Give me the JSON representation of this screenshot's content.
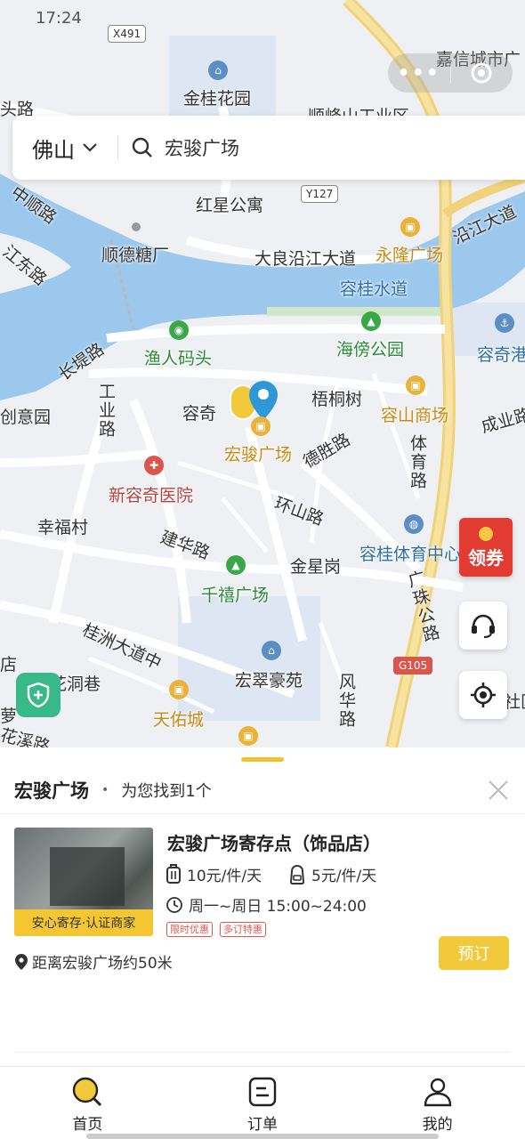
{
  "status_bar": {
    "time": "17:24"
  },
  "capsule": {
    "more_label": "•••"
  },
  "search": {
    "city": "佛山",
    "query": "宏骏广场"
  },
  "map": {
    "labels": {
      "x491": "X491",
      "jinguihuayuan": "金桂花园",
      "shunfengshan": "顺峰山工业区",
      "jiaxincheng": "嘉信城市广",
      "toulu": "头路",
      "y127": "Y127",
      "hongxinggongyu": "红星公寓",
      "zhongshunlu": "中顺路",
      "shundetangchang": "顺德糖厂",
      "dalianganjiang": "大良沿江大道",
      "yonglongguangchang": "永隆广场",
      "yanjiangdadao": "沿江大道",
      "jiangdonglu": "江东路",
      "rongguishuidao": "容桂水道",
      "yurenmatou": "渔人码头",
      "haibanggongyuan": "海傍公园",
      "rongqigang": "容奇港",
      "changdilu": "长堤路",
      "chuangyiyuan": "创意园",
      "gongyelu": "工业路",
      "rongqi": "容奇",
      "wutongshu": "梧桐树",
      "rongshanshangchang": "容山商场",
      "chengyelu": "成业路",
      "hongjunguangchang": "宏骏广场",
      "deshenglu": "德胜路",
      "tiyulu": "体育路",
      "xinrongqiyiyuan": "新容奇医院",
      "huanshanlu": "环山路",
      "xingfucun": "幸福村",
      "jianhualu": "建华路",
      "rongguitiyuzhongxin": "容桂体育中心",
      "jinxinggang": "金星岗",
      "qianxiguangchang": "千禧广场",
      "guangzhugonglu": "广珠公路",
      "guizhoudadaozhong": "桂洲大道中",
      "hongcuihaoyuan": "宏翠豪苑",
      "dian": "店",
      "huadongxiang": "花洞巷",
      "g105": "G105",
      "fenghualu": "风华路",
      "tianyoucheng": "天佑城",
      "meng": "萝",
      "shequ": "社区",
      "hualilu": "花溪路"
    }
  },
  "coupon": {
    "label": "领券"
  },
  "sheet": {
    "title": "宏骏广场",
    "dot": "•",
    "count_text": "为您找到1个",
    "store": {
      "ribbon": "安心寄存·认证商家",
      "name": "宏骏广场寄存点（饰品店）",
      "price_big": "10元/件/天",
      "price_small": "5元/件/天",
      "hours": "周一~周日 15:00~24:00",
      "tags": [
        "限时优惠",
        "多订特惠"
      ],
      "book_label": "预订",
      "distance": "距离宏骏广场约50米"
    }
  },
  "tabbar": {
    "home": "首页",
    "orders": "订单",
    "mine": "我的"
  },
  "colors": {
    "accent": "#f2c93a",
    "river": "#9cc8ee",
    "coupon": "#e23b32"
  }
}
